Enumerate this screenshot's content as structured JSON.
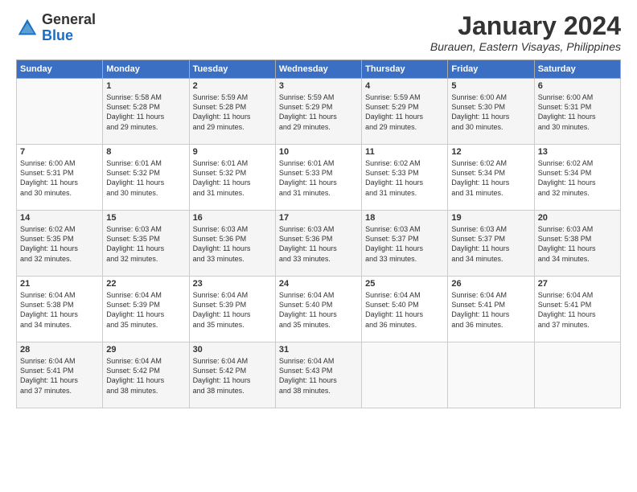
{
  "header": {
    "logo_general": "General",
    "logo_blue": "Blue",
    "month_title": "January 2024",
    "location": "Burauen, Eastern Visayas, Philippines"
  },
  "weekdays": [
    "Sunday",
    "Monday",
    "Tuesday",
    "Wednesday",
    "Thursday",
    "Friday",
    "Saturday"
  ],
  "weeks": [
    [
      {
        "day": "",
        "info": ""
      },
      {
        "day": "1",
        "info": "Sunrise: 5:58 AM\nSunset: 5:28 PM\nDaylight: 11 hours\nand 29 minutes."
      },
      {
        "day": "2",
        "info": "Sunrise: 5:59 AM\nSunset: 5:28 PM\nDaylight: 11 hours\nand 29 minutes."
      },
      {
        "day": "3",
        "info": "Sunrise: 5:59 AM\nSunset: 5:29 PM\nDaylight: 11 hours\nand 29 minutes."
      },
      {
        "day": "4",
        "info": "Sunrise: 5:59 AM\nSunset: 5:29 PM\nDaylight: 11 hours\nand 29 minutes."
      },
      {
        "day": "5",
        "info": "Sunrise: 6:00 AM\nSunset: 5:30 PM\nDaylight: 11 hours\nand 30 minutes."
      },
      {
        "day": "6",
        "info": "Sunrise: 6:00 AM\nSunset: 5:31 PM\nDaylight: 11 hours\nand 30 minutes."
      }
    ],
    [
      {
        "day": "7",
        "info": "Sunrise: 6:00 AM\nSunset: 5:31 PM\nDaylight: 11 hours\nand 30 minutes."
      },
      {
        "day": "8",
        "info": "Sunrise: 6:01 AM\nSunset: 5:32 PM\nDaylight: 11 hours\nand 30 minutes."
      },
      {
        "day": "9",
        "info": "Sunrise: 6:01 AM\nSunset: 5:32 PM\nDaylight: 11 hours\nand 31 minutes."
      },
      {
        "day": "10",
        "info": "Sunrise: 6:01 AM\nSunset: 5:33 PM\nDaylight: 11 hours\nand 31 minutes."
      },
      {
        "day": "11",
        "info": "Sunrise: 6:02 AM\nSunset: 5:33 PM\nDaylight: 11 hours\nand 31 minutes."
      },
      {
        "day": "12",
        "info": "Sunrise: 6:02 AM\nSunset: 5:34 PM\nDaylight: 11 hours\nand 31 minutes."
      },
      {
        "day": "13",
        "info": "Sunrise: 6:02 AM\nSunset: 5:34 PM\nDaylight: 11 hours\nand 32 minutes."
      }
    ],
    [
      {
        "day": "14",
        "info": "Sunrise: 6:02 AM\nSunset: 5:35 PM\nDaylight: 11 hours\nand 32 minutes."
      },
      {
        "day": "15",
        "info": "Sunrise: 6:03 AM\nSunset: 5:35 PM\nDaylight: 11 hours\nand 32 minutes."
      },
      {
        "day": "16",
        "info": "Sunrise: 6:03 AM\nSunset: 5:36 PM\nDaylight: 11 hours\nand 33 minutes."
      },
      {
        "day": "17",
        "info": "Sunrise: 6:03 AM\nSunset: 5:36 PM\nDaylight: 11 hours\nand 33 minutes."
      },
      {
        "day": "18",
        "info": "Sunrise: 6:03 AM\nSunset: 5:37 PM\nDaylight: 11 hours\nand 33 minutes."
      },
      {
        "day": "19",
        "info": "Sunrise: 6:03 AM\nSunset: 5:37 PM\nDaylight: 11 hours\nand 34 minutes."
      },
      {
        "day": "20",
        "info": "Sunrise: 6:03 AM\nSunset: 5:38 PM\nDaylight: 11 hours\nand 34 minutes."
      }
    ],
    [
      {
        "day": "21",
        "info": "Sunrise: 6:04 AM\nSunset: 5:38 PM\nDaylight: 11 hours\nand 34 minutes."
      },
      {
        "day": "22",
        "info": "Sunrise: 6:04 AM\nSunset: 5:39 PM\nDaylight: 11 hours\nand 35 minutes."
      },
      {
        "day": "23",
        "info": "Sunrise: 6:04 AM\nSunset: 5:39 PM\nDaylight: 11 hours\nand 35 minutes."
      },
      {
        "day": "24",
        "info": "Sunrise: 6:04 AM\nSunset: 5:40 PM\nDaylight: 11 hours\nand 35 minutes."
      },
      {
        "day": "25",
        "info": "Sunrise: 6:04 AM\nSunset: 5:40 PM\nDaylight: 11 hours\nand 36 minutes."
      },
      {
        "day": "26",
        "info": "Sunrise: 6:04 AM\nSunset: 5:41 PM\nDaylight: 11 hours\nand 36 minutes."
      },
      {
        "day": "27",
        "info": "Sunrise: 6:04 AM\nSunset: 5:41 PM\nDaylight: 11 hours\nand 37 minutes."
      }
    ],
    [
      {
        "day": "28",
        "info": "Sunrise: 6:04 AM\nSunset: 5:41 PM\nDaylight: 11 hours\nand 37 minutes."
      },
      {
        "day": "29",
        "info": "Sunrise: 6:04 AM\nSunset: 5:42 PM\nDaylight: 11 hours\nand 38 minutes."
      },
      {
        "day": "30",
        "info": "Sunrise: 6:04 AM\nSunset: 5:42 PM\nDaylight: 11 hours\nand 38 minutes."
      },
      {
        "day": "31",
        "info": "Sunrise: 6:04 AM\nSunset: 5:43 PM\nDaylight: 11 hours\nand 38 minutes."
      },
      {
        "day": "",
        "info": ""
      },
      {
        "day": "",
        "info": ""
      },
      {
        "day": "",
        "info": ""
      }
    ]
  ]
}
